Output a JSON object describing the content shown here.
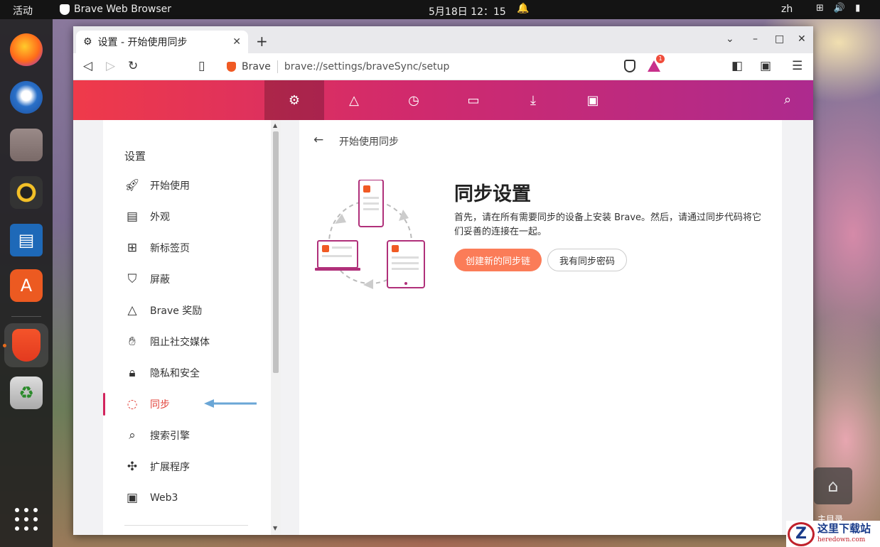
{
  "topbar": {
    "activities": "活动",
    "app_name": "Brave Web Browser",
    "clock": "5月18日 12：15",
    "lang": "zh"
  },
  "tab": {
    "title": "设置 - 开始使用同步",
    "new_tab": "+",
    "close": "✕"
  },
  "window_controls": {
    "dropdown": "⌄",
    "minimize": "–",
    "maximize": "□",
    "close": "✕"
  },
  "address": {
    "site": "Brave",
    "url": "brave://settings/braveSync/setup"
  },
  "extension_badge_count": "1",
  "sidebar": {
    "heading": "设置",
    "items": [
      {
        "label": "开始使用",
        "icon": "rocket-icon"
      },
      {
        "label": "外观",
        "icon": "appearance-icon"
      },
      {
        "label": "新标签页",
        "icon": "new-tab-icon"
      },
      {
        "label": "屏蔽",
        "icon": "shield-icon"
      },
      {
        "label": "Brave 奖励",
        "icon": "rewards-icon"
      },
      {
        "label": "阻止社交媒体",
        "icon": "thumbs-down-icon"
      },
      {
        "label": "隐私和安全",
        "icon": "lock-icon"
      },
      {
        "label": "同步",
        "icon": "sync-icon"
      },
      {
        "label": "搜索引擎",
        "icon": "search-icon"
      },
      {
        "label": "扩展程序",
        "icon": "puzzle-icon"
      },
      {
        "label": "Web3",
        "icon": "wallet-icon"
      }
    ],
    "active_index": 7
  },
  "main": {
    "breadcrumb": "开始使用同步",
    "title": "同步设置",
    "description": "首先，请在所有需要同步的设备上安装 Brave。然后，请通过同步代码将它们妥善的连接在一起。",
    "primary_button": "创建新的同步链",
    "secondary_button": "我有同步密码"
  },
  "desktop": {
    "home_label": "主目录"
  },
  "watermark": {
    "title": "这里下载站",
    "url": "heredown.com",
    "logo_letter": "Z"
  },
  "colors": {
    "accent": "#fb7c58",
    "nav_start": "#ef3a4a",
    "nav_end": "#ad2a8e",
    "active": "#e2443c"
  }
}
